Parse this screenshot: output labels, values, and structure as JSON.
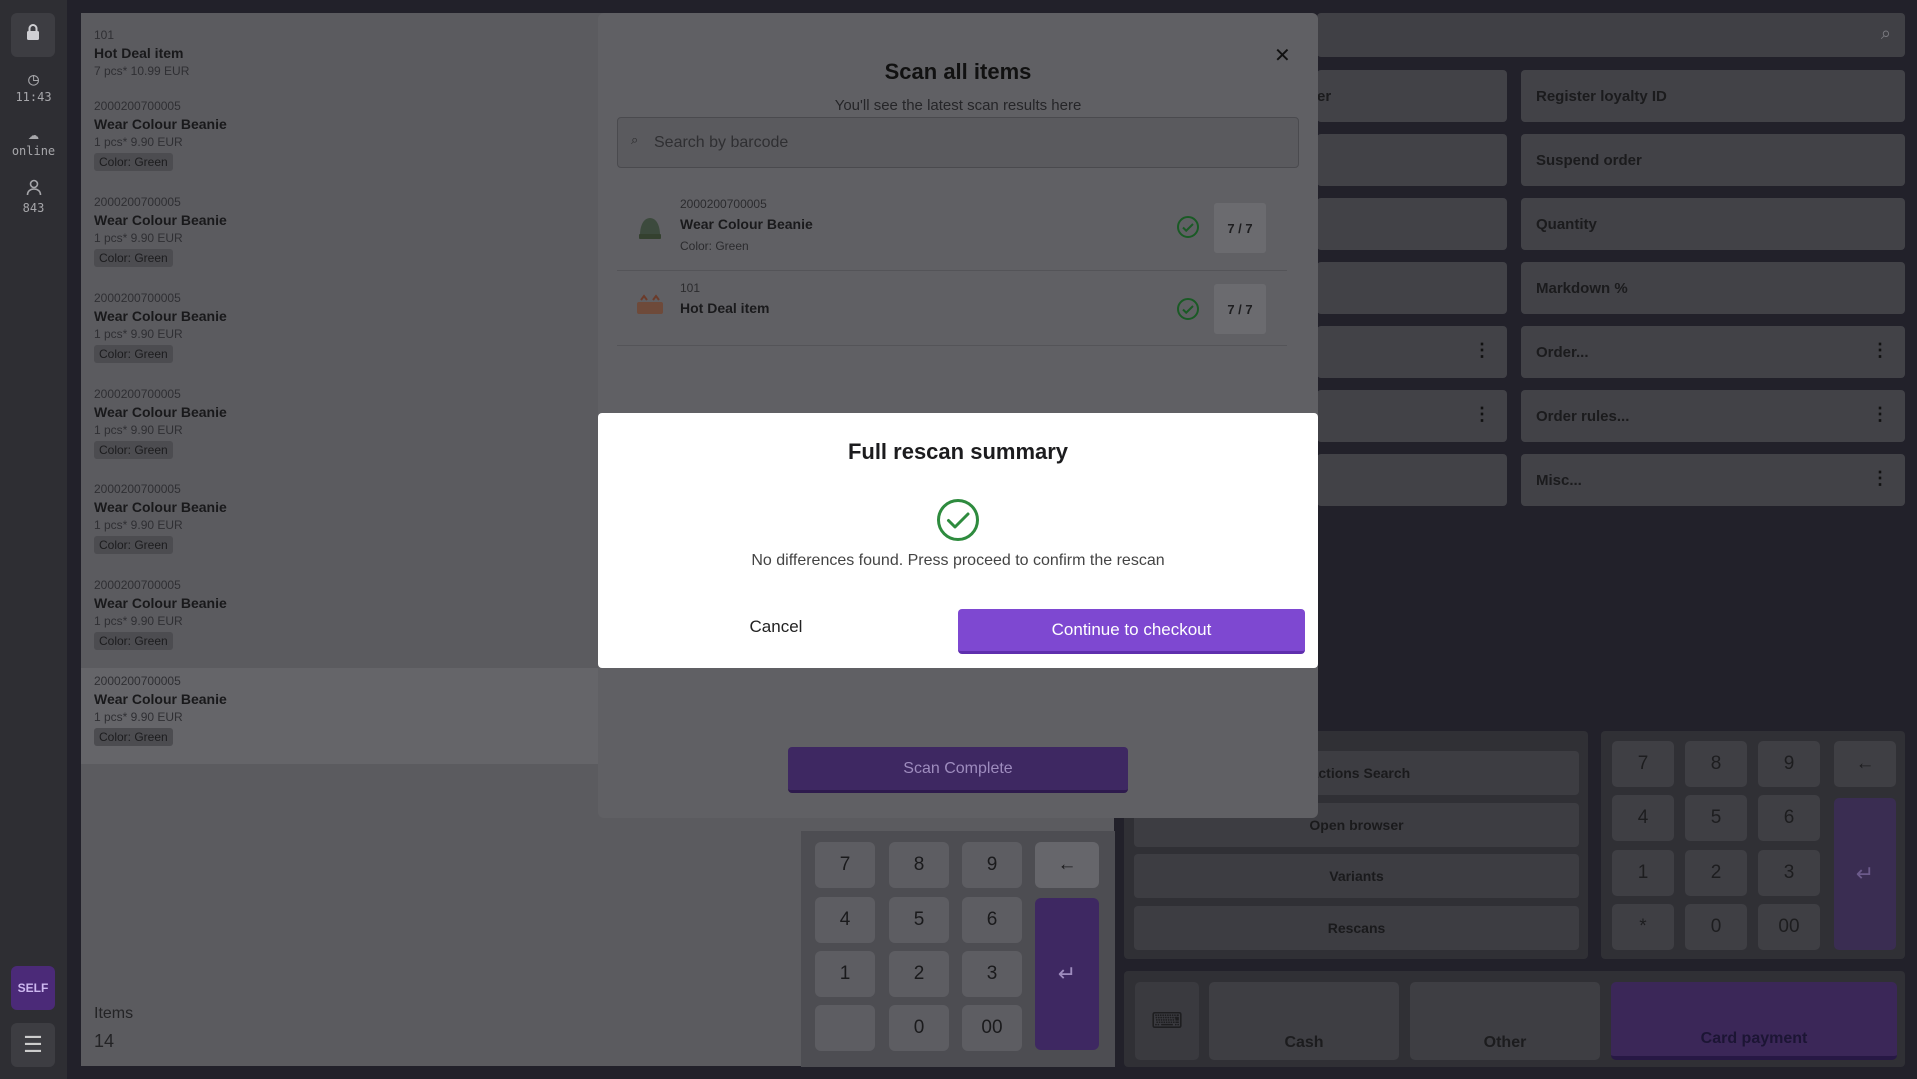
{
  "sidebar": {
    "time": "11:43",
    "status": "online",
    "user_id": "843",
    "self_label": "SELF"
  },
  "order": {
    "items": [
      {
        "code": "101",
        "name": "Hot Deal item",
        "qty": "7 pcs* 10.99 EUR",
        "tag": ""
      },
      {
        "code": "2000200700005",
        "name": "Wear Colour Beanie",
        "qty": "1 pcs* 9.90 EUR",
        "tag": "Color: Green"
      },
      {
        "code": "2000200700005",
        "name": "Wear Colour Beanie",
        "qty": "1 pcs* 9.90 EUR",
        "tag": "Color: Green"
      },
      {
        "code": "2000200700005",
        "name": "Wear Colour Beanie",
        "qty": "1 pcs* 9.90 EUR",
        "tag": "Color: Green"
      },
      {
        "code": "2000200700005",
        "name": "Wear Colour Beanie",
        "qty": "1 pcs* 9.90 EUR",
        "tag": "Color: Green"
      },
      {
        "code": "2000200700005",
        "name": "Wear Colour Beanie",
        "qty": "1 pcs* 9.90 EUR",
        "tag": "Color: Green"
      },
      {
        "code": "2000200700005",
        "name": "Wear Colour Beanie",
        "qty": "1 pcs* 9.90 EUR",
        "tag": "Color: Green"
      },
      {
        "code": "2000200700005",
        "name": "Wear Colour Beanie",
        "qty": "1 pcs* 9.90 EUR",
        "tag": "Color: Green"
      }
    ],
    "items_label": "Items",
    "items_count": "14"
  },
  "numpad": {
    "keys": [
      "7",
      "8",
      "9",
      "4",
      "5",
      "6",
      "1",
      "2",
      "3",
      "",
      "0",
      "00"
    ],
    "backspace": "←",
    "enter": "↵"
  },
  "functions": {
    "left": [
      "er",
      "",
      "",
      "",
      "",
      "",
      ""
    ],
    "right": [
      "Register loyalty ID",
      "Suspend order",
      "Quantity",
      "Markdown %",
      "Order...",
      "Order rules...",
      "Misc..."
    ]
  },
  "misc": {
    "buttons": [
      "sactions Search",
      "Open browser",
      "Variants",
      "Rescans"
    ]
  },
  "right_numpad": {
    "keys": [
      "7",
      "8",
      "9",
      "4",
      "5",
      "6",
      "1",
      "2",
      "3",
      "*",
      "0",
      "00"
    ],
    "backspace": "←",
    "enter": "↵"
  },
  "payment": {
    "cash": "Cash",
    "other": "Other",
    "card": "Card payment"
  },
  "scan_modal": {
    "title": "Scan all items",
    "subtitle": "You'll see the latest scan results here",
    "search_placeholder": "Search by barcode",
    "results": [
      {
        "code": "2000200700005",
        "name": "Wear Colour Beanie",
        "color": "Color: Green",
        "count": "7 / 7",
        "thumb": "beanie"
      },
      {
        "code": "101",
        "name": "Hot Deal item",
        "color": "",
        "count": "7 / 7",
        "thumb": "hot-deal"
      }
    ],
    "complete_label": "Scan Complete"
  },
  "summary": {
    "title": "Full rescan summary",
    "message": "No differences found. Press proceed to confirm the rescan",
    "cancel_label": "Cancel",
    "continue_label": "Continue to checkout"
  },
  "colors": {
    "accent": "#7e48d1",
    "success": "#2e8b3e"
  }
}
